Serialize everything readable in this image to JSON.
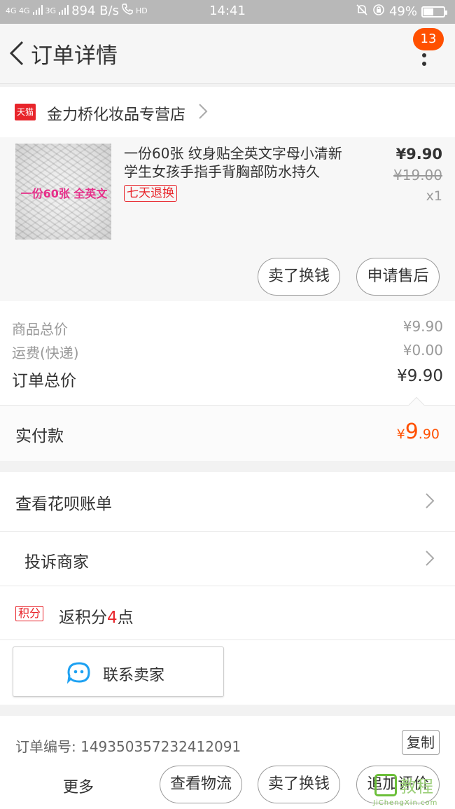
{
  "status_bar": {
    "network": "4G 4G",
    "network2": "3G",
    "speed": "894 B/s",
    "hd": "HD",
    "time": "14:41",
    "battery": "49%"
  },
  "header": {
    "title": "订单详情",
    "badge_count": "13"
  },
  "store": {
    "tag": "天猫",
    "name": "金力桥化妆品专营店"
  },
  "product": {
    "thumb_text": "一份60张 全英文",
    "title": "一份60张 纹身贴全英文字母小清新学生女孩手指手背胸部防水持久",
    "return_tag": "七天退换",
    "price": "¥9.90",
    "original_price": "¥19.00",
    "quantity": "x1",
    "btn_resell": "卖了换钱",
    "btn_aftersale": "申请售后"
  },
  "summary": {
    "goods_label": "商品总价",
    "goods_value": "¥9.90",
    "shipping_label": "运费(快递)",
    "shipping_value": "¥0.00",
    "total_label": "订单总价",
    "total_value": "¥9.90"
  },
  "paid": {
    "label": "实付款",
    "symbol": "¥",
    "int": "9",
    "dec": ".90"
  },
  "menu": {
    "huabei": "查看花呗账单",
    "complain": "投诉商家",
    "points_tag": "积分",
    "points_pre": "返积分",
    "points_num": "4",
    "points_post": "点",
    "contact": "联系卖家"
  },
  "order": {
    "number_label": "订单编号:",
    "number": "149350357232412091",
    "copy": "复制"
  },
  "bottom_bar": {
    "more": "更多",
    "logistics": "查看物流",
    "resell": "卖了换钱",
    "review": "追加评价"
  },
  "watermark": {
    "text": "教程",
    "site": "JiChengXin.com"
  },
  "colors": {
    "accent": "#ff5000",
    "tmall_red": "#e8252b",
    "status_bar": "#b8b8b8"
  }
}
